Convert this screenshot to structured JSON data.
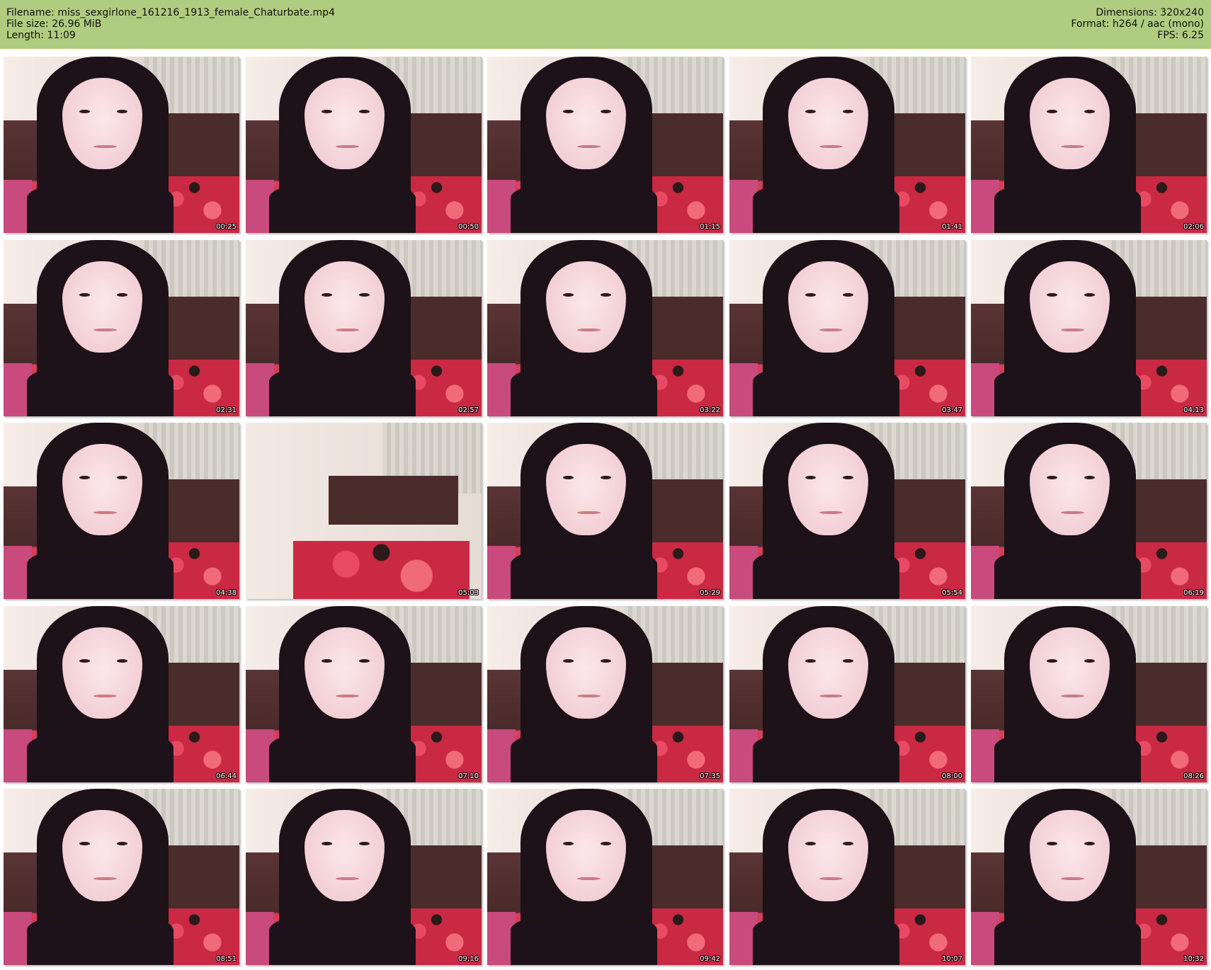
{
  "header": {
    "left": [
      {
        "label": "Filename:",
        "value": "miss_sexgirlone_161216_1913_female_Chaturbate.mp4"
      },
      {
        "label": "File size:",
        "value": "26.96 MiB"
      },
      {
        "label": "Length:",
        "value": "11:09"
      }
    ],
    "right": [
      {
        "label": "Dimensions:",
        "value": "320x240"
      },
      {
        "label": "Format:",
        "value": "h264 / aac (mono)"
      },
      {
        "label": "FPS:",
        "value": "6.25"
      }
    ],
    "background_color": "#b0cc80"
  },
  "thumbnails": [
    {
      "timestamp": "00:25",
      "scene": "person"
    },
    {
      "timestamp": "00:50",
      "scene": "person"
    },
    {
      "timestamp": "01:15",
      "scene": "person"
    },
    {
      "timestamp": "01:41",
      "scene": "person"
    },
    {
      "timestamp": "02:06",
      "scene": "person"
    },
    {
      "timestamp": "02:31",
      "scene": "person"
    },
    {
      "timestamp": "02:57",
      "scene": "person"
    },
    {
      "timestamp": "03:22",
      "scene": "person"
    },
    {
      "timestamp": "03:47",
      "scene": "person"
    },
    {
      "timestamp": "04:13",
      "scene": "person"
    },
    {
      "timestamp": "04:38",
      "scene": "person"
    },
    {
      "timestamp": "05:03",
      "scene": "room"
    },
    {
      "timestamp": "05:29",
      "scene": "person"
    },
    {
      "timestamp": "05:54",
      "scene": "person"
    },
    {
      "timestamp": "06:19",
      "scene": "person"
    },
    {
      "timestamp": "06:44",
      "scene": "person"
    },
    {
      "timestamp": "07:10",
      "scene": "person"
    },
    {
      "timestamp": "07:35",
      "scene": "person"
    },
    {
      "timestamp": "08:00",
      "scene": "person"
    },
    {
      "timestamp": "08:26",
      "scene": "person"
    },
    {
      "timestamp": "08:51",
      "scene": "person"
    },
    {
      "timestamp": "09:16",
      "scene": "person"
    },
    {
      "timestamp": "09:42",
      "scene": "person"
    },
    {
      "timestamp": "10:07",
      "scene": "person"
    },
    {
      "timestamp": "10:32",
      "scene": "person"
    }
  ]
}
